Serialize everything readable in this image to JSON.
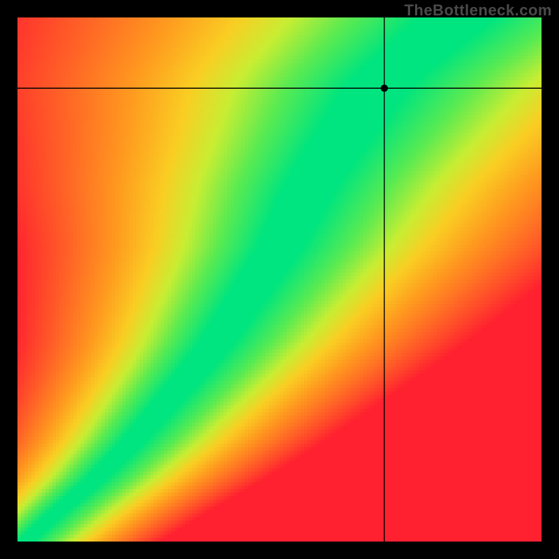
{
  "watermark": "TheBottleneck.com",
  "chart_data": {
    "type": "heatmap",
    "title": "",
    "xlabel": "",
    "ylabel": "",
    "xlim": [
      0,
      1
    ],
    "ylim": [
      0,
      1
    ],
    "grid_resolution": 150,
    "point": {
      "x": 0.7,
      "y": 0.865
    },
    "crosshair": {
      "v_at_x": 0.7,
      "h_at_y": 0.865
    },
    "ridge": {
      "description": "Green optimal band as (x_normalized, y_normalized) pairs from bottom-left toward upper-right; band widens with y.",
      "points": [
        [
          0.015,
          0.0
        ],
        [
          0.08,
          0.06
        ],
        [
          0.15,
          0.12
        ],
        [
          0.22,
          0.19
        ],
        [
          0.28,
          0.26
        ],
        [
          0.34,
          0.33
        ],
        [
          0.38,
          0.38
        ],
        [
          0.42,
          0.44
        ],
        [
          0.46,
          0.5
        ],
        [
          0.5,
          0.56
        ],
        [
          0.53,
          0.62
        ],
        [
          0.56,
          0.68
        ],
        [
          0.6,
          0.74
        ],
        [
          0.64,
          0.8
        ],
        [
          0.68,
          0.86
        ],
        [
          0.72,
          0.9
        ],
        [
          0.78,
          0.95
        ],
        [
          0.84,
          1.0
        ]
      ],
      "base_half_width": 0.015,
      "width_growth": 0.055
    },
    "colorscale": [
      {
        "t": 0.0,
        "hex": "#00e57f"
      },
      {
        "t": 0.16,
        "hex": "#59eb52"
      },
      {
        "t": 0.3,
        "hex": "#c8ee33"
      },
      {
        "t": 0.42,
        "hex": "#face23"
      },
      {
        "t": 0.58,
        "hex": "#ff9a1f"
      },
      {
        "t": 0.8,
        "hex": "#ff5a28"
      },
      {
        "t": 1.0,
        "hex": "#ff2030"
      }
    ]
  }
}
